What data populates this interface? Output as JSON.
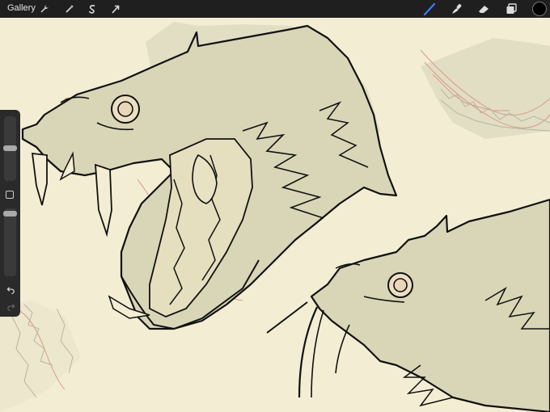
{
  "topbar": {
    "gallery_label": "Gallery",
    "left_tools": [
      "wrench-icon",
      "magic-wand-icon",
      "selection-s-icon",
      "transform-arrow-icon"
    ],
    "right_tools": [
      "brush-icon",
      "smudge-icon",
      "eraser-icon",
      "layers-icon",
      "color-swatch"
    ],
    "brush_color": "#3b7bff",
    "current_color": "#000000"
  },
  "canvas": {
    "background": "#f3eed3",
    "fill": "#d9d6b7",
    "sketch_red": "#d99a8a",
    "sketch_grey": "#a9a79a"
  },
  "sidebar": {
    "size_level": 0.5,
    "opacity_level": 0.95
  }
}
